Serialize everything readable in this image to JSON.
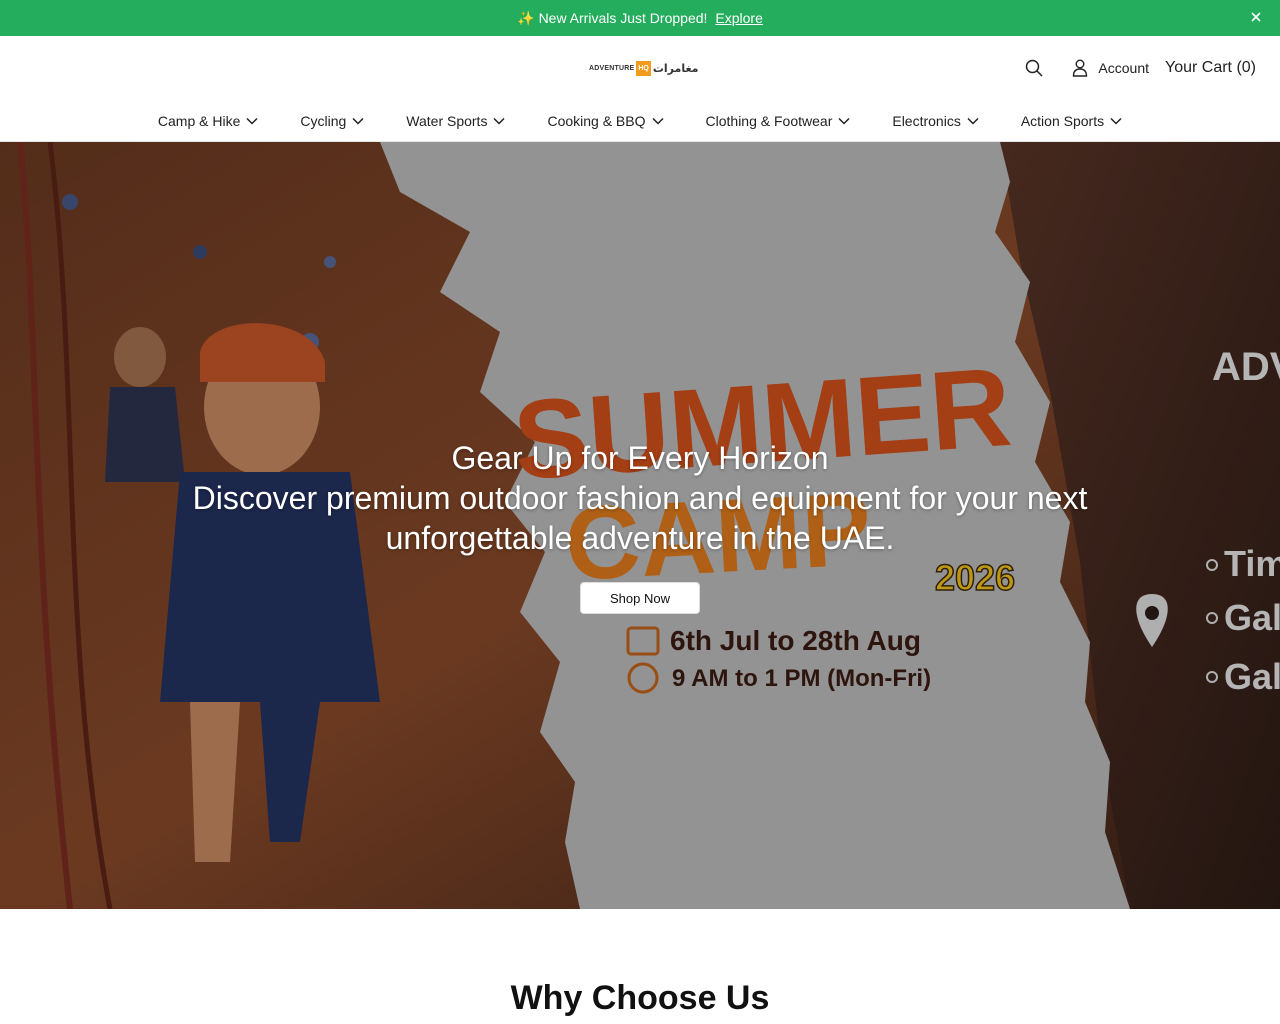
{
  "announcement": {
    "sparkle": "✨",
    "text": "New Arrivals Just Dropped!",
    "link": "Explore",
    "close_icon": "close-icon"
  },
  "header": {
    "logo": {
      "en": "ADVENTURE",
      "hq": "HQ",
      "ar": "مغامرات"
    },
    "search_icon": "search-icon",
    "account_label": "Account",
    "account_icon": "user-icon",
    "cart_label": "Your Cart (0)"
  },
  "nav": {
    "items": [
      {
        "label": "Camp & Hike"
      },
      {
        "label": "Cycling"
      },
      {
        "label": "Water Sports"
      },
      {
        "label": "Cooking & BBQ"
      },
      {
        "label": "Clothing & Footwear"
      },
      {
        "label": "Electronics"
      },
      {
        "label": "Action Sports"
      }
    ],
    "dropdown_icon": "chevron-down-icon"
  },
  "hero": {
    "title": "Gear Up for Every Horizon",
    "subtitle": "Discover premium outdoor fashion and equipment for your next unforgettable adventure in the UAE.",
    "button": "Shop Now",
    "banner": {
      "line1": "SUMMER",
      "line2": "CAMP",
      "year": "2026",
      "dates": "6th Jul to 28th Aug",
      "time": "9 AM to 1 PM (Mon-Fri)",
      "side_heading": "ADV",
      "side_items": [
        "Tim",
        "Gall",
        "Gall"
      ]
    }
  },
  "section": {
    "title": "Why Choose Us"
  },
  "colors": {
    "announce_bg": "#23ad5c",
    "logo_accent": "#f39b1c",
    "banner_orange": "#d3501c"
  }
}
